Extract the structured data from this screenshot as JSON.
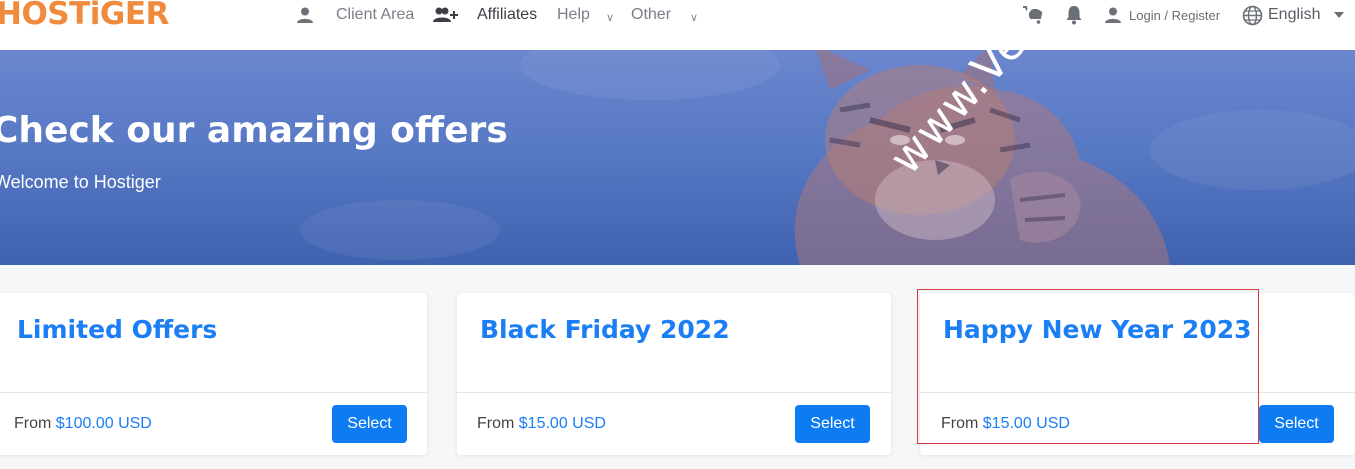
{
  "header": {
    "logo": "HOSTiGER",
    "nav": {
      "client_area": "Client Area",
      "affiliates": "Affiliates",
      "help": "Help",
      "other": "Other"
    },
    "chevron": "∨",
    "login": "Login / Register",
    "language": "English"
  },
  "hero": {
    "title": "Check our amazing offers",
    "subtitle": "Welcome to Hostiger",
    "watermark": "www.Veldc.com"
  },
  "cards": [
    {
      "title": "Limited Offers",
      "from_label": "From",
      "price": "$100.00 USD",
      "button": "Select"
    },
    {
      "title": "Black Friday 2022",
      "from_label": "From",
      "price": "$15.00 USD",
      "button": "Select"
    },
    {
      "title": "Happy New Year 2023",
      "from_label": "From",
      "price": "$15.00 USD",
      "button": "Select"
    }
  ],
  "colors": {
    "brand_orange": "#f08a3c",
    "accent_blue": "#1b7ef5",
    "button_blue": "#0d7cf2",
    "hero_blue": "#5879c4",
    "highlight_red": "#d63a3a"
  },
  "icons": [
    "user-icon",
    "user-plus-icon",
    "cart-icon",
    "bell-icon",
    "globe-icon",
    "caret-down-icon",
    "chevron-down-icon"
  ]
}
